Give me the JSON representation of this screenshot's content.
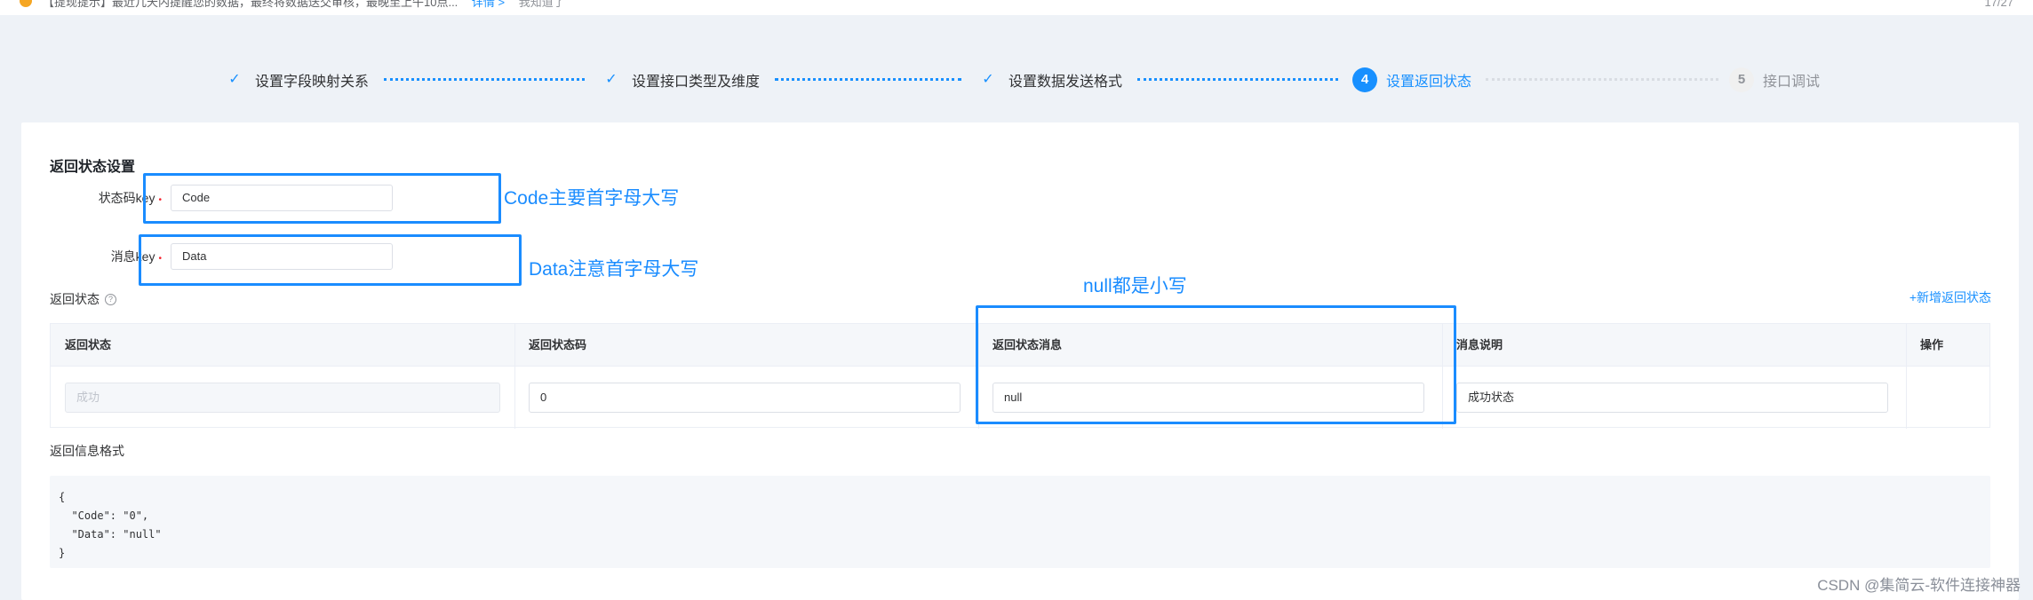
{
  "notice": {
    "text": "【提现提示】最近几天内提醒您的数据，最终将数据送交审核，最晚至上午10点...",
    "link": "详情 >",
    "extra": "我知道了",
    "page": "17/27"
  },
  "steps": [
    {
      "label": "设置字段映射关系",
      "status": "done"
    },
    {
      "label": "设置接口类型及维度",
      "status": "done"
    },
    {
      "label": "设置数据发送格式",
      "status": "done"
    },
    {
      "num": "4",
      "label": "设置返回状态",
      "status": "active"
    },
    {
      "num": "5",
      "label": "接口调试",
      "status": "pending"
    }
  ],
  "form": {
    "section_title": "返回状态设置",
    "status_key_label": "状态码key",
    "status_key_value": "Code",
    "message_key_label": "消息key",
    "message_key_value": "Data",
    "required_mark": "•"
  },
  "annotations": {
    "code_note": "Code主要首字母大写",
    "data_note": "Data注意首字母大写",
    "null_note": "null都是小写"
  },
  "return_status": {
    "title": "返回状态",
    "help_icon": "?",
    "add_link": "+新增返回状态",
    "columns": [
      "返回状态",
      "返回状态码",
      "返回状态消息",
      "消息说明",
      "操作"
    ],
    "rows": [
      {
        "status": "成功",
        "code": "0",
        "message": "null",
        "description": "成功状态"
      }
    ]
  },
  "format": {
    "title": "返回信息格式",
    "code": "{\n  \"Code\": \"0\",\n  \"Data\": \"null\"\n}"
  },
  "watermark": "CSDN @集简云-软件连接神器",
  "colors": {
    "accent": "#1890ff",
    "annotation": "#1a8cff"
  }
}
